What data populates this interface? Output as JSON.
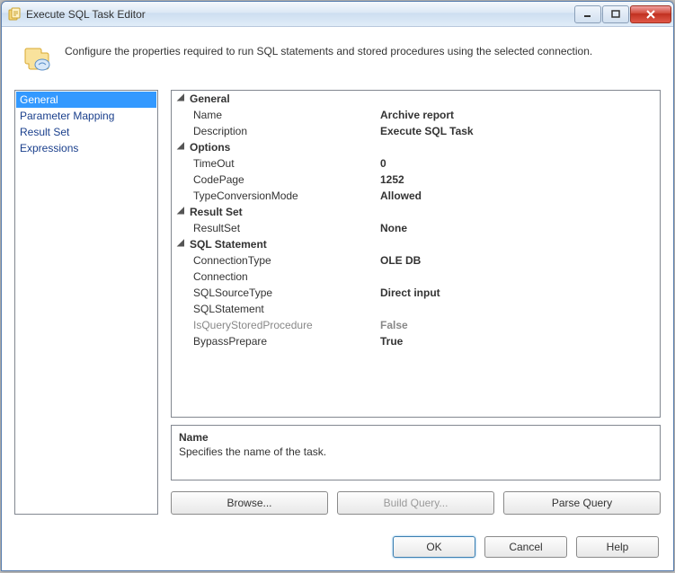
{
  "window": {
    "title": "Execute SQL Task Editor"
  },
  "header": {
    "text": "Configure the properties required to run SQL statements and stored procedures using the selected connection."
  },
  "nav": {
    "items": [
      "General",
      "Parameter Mapping",
      "Result Set",
      "Expressions"
    ],
    "selected": 0
  },
  "grid": {
    "groups": [
      {
        "name": "General",
        "props": [
          {
            "label": "Name",
            "value": "Archive report"
          },
          {
            "label": "Description",
            "value": "Execute SQL Task"
          }
        ]
      },
      {
        "name": "Options",
        "props": [
          {
            "label": "TimeOut",
            "value": "0"
          },
          {
            "label": "CodePage",
            "value": "1252"
          },
          {
            "label": "TypeConversionMode",
            "value": "Allowed"
          }
        ]
      },
      {
        "name": "Result Set",
        "props": [
          {
            "label": "ResultSet",
            "value": "None"
          }
        ]
      },
      {
        "name": "SQL Statement",
        "props": [
          {
            "label": "ConnectionType",
            "value": "OLE DB"
          },
          {
            "label": "Connection",
            "value": ""
          },
          {
            "label": "SQLSourceType",
            "value": "Direct input"
          },
          {
            "label": "SQLStatement",
            "value": ""
          },
          {
            "label": "IsQueryStoredProcedure",
            "value": "False",
            "disabled": true
          },
          {
            "label": "BypassPrepare",
            "value": "True"
          }
        ]
      }
    ]
  },
  "description": {
    "title": "Name",
    "text": "Specifies the name of the task."
  },
  "actions": {
    "browse": "Browse...",
    "build": "Build Query...",
    "parse": "Parse Query"
  },
  "footer": {
    "ok": "OK",
    "cancel": "Cancel",
    "help": "Help"
  }
}
